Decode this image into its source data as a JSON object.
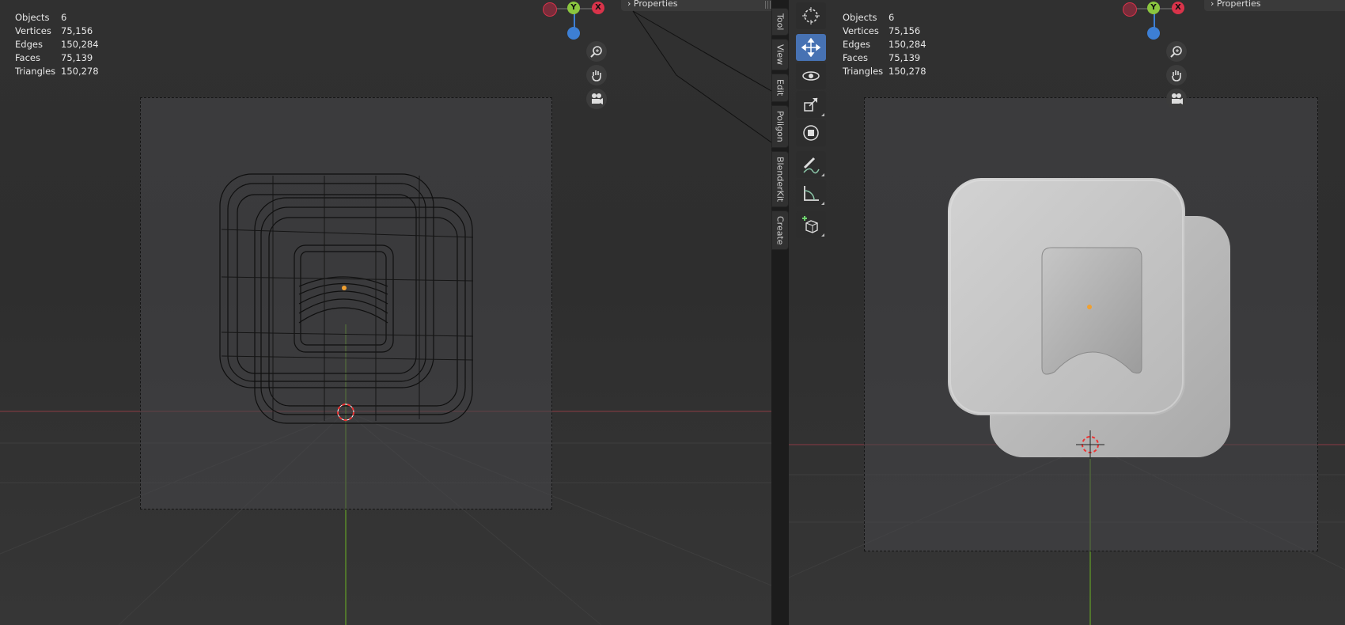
{
  "left_viewport": {
    "stats": [
      {
        "label": "Objects",
        "value": "6"
      },
      {
        "label": "Vertices",
        "value": "75,156"
      },
      {
        "label": "Edges",
        "value": "150,284"
      },
      {
        "label": "Faces",
        "value": "75,139"
      },
      {
        "label": "Triangles",
        "value": "150,278"
      }
    ],
    "properties_label": "Properties"
  },
  "right_viewport": {
    "stats": [
      {
        "label": "Objects",
        "value": "6"
      },
      {
        "label": "Vertices",
        "value": "75,156"
      },
      {
        "label": "Edges",
        "value": "150,284"
      },
      {
        "label": "Faces",
        "value": "75,139"
      },
      {
        "label": "Triangles",
        "value": "150,278"
      }
    ],
    "properties_label": "Properties"
  },
  "gizmo": {
    "y_label": "Y",
    "x_label": "X"
  },
  "sidebar_tabs": [
    "Tool",
    "View",
    "Edit",
    "Poligon",
    "BlenderKit",
    "Create"
  ],
  "toolbar_tools": [
    {
      "name": "cursor-tool",
      "active": false
    },
    {
      "name": "move-tool",
      "active": true
    },
    {
      "name": "rotate-tool",
      "active": false
    },
    {
      "name": "scale-tool",
      "active": false
    },
    {
      "name": "transform-tool",
      "active": false
    },
    {
      "name": "annotate-tool",
      "active": false
    },
    {
      "name": "measure-tool",
      "active": false
    },
    {
      "name": "add-cube-tool",
      "active": false
    }
  ],
  "colors": {
    "axis_x": "#d9334a",
    "axis_y": "#8bc63f",
    "axis_z": "#3d7fd4",
    "active_tool": "#4772b3",
    "origin": "#f0a030"
  }
}
